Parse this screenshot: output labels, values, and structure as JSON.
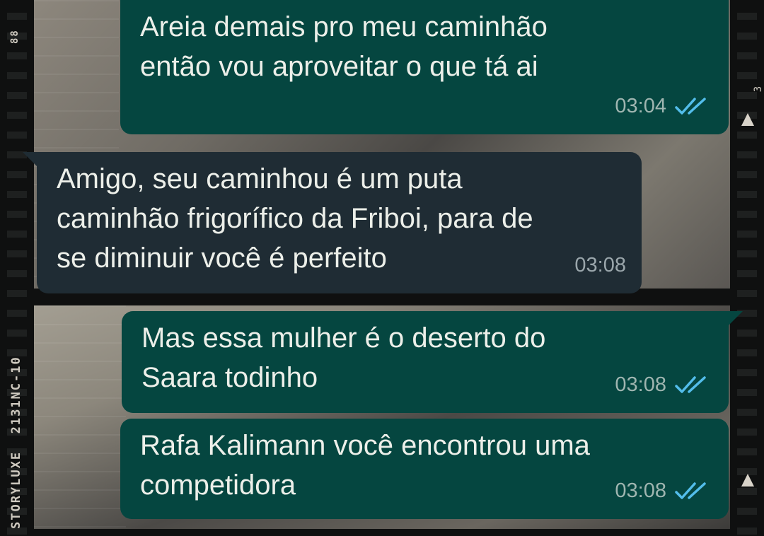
{
  "wallpaper": {
    "film_brand": "STORYLUXE",
    "film_code": "2131NC-10",
    "frame_number_top": "88",
    "frame_number_right": "3"
  },
  "messages": [
    {
      "direction": "outgoing",
      "text": "Areia demais pro meu caminhão\nentão vou aproveitar o que tá ai",
      "time": "03:04",
      "status_icon": "double-check-read-icon"
    },
    {
      "direction": "incoming",
      "text": "Amigo, seu caminhou é um puta\ncaminhão frigorífico da Friboi, para de\nse diminuir você é perfeito",
      "time": "03:08"
    },
    {
      "direction": "outgoing",
      "text": "Mas essa mulher é o deserto do\nSaara todinho",
      "time": "03:08",
      "status_icon": "double-check-read-icon"
    },
    {
      "direction": "outgoing",
      "text": "Rafa Kalimann você encontrou uma\ncompetidora",
      "time": "03:08",
      "status_icon": "double-check-read-icon"
    }
  ],
  "colors": {
    "outgoing_bubble": "#054640",
    "incoming_bubble": "#1f2c34",
    "read_check": "#53bdeb",
    "text": "#ecefe9"
  }
}
